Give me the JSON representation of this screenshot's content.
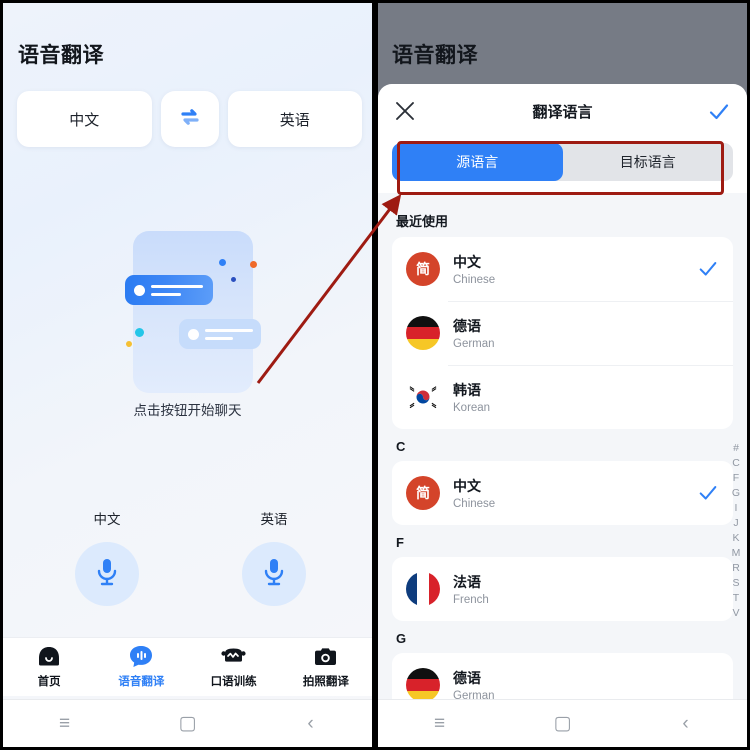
{
  "left": {
    "title": "语音翻译",
    "source_lang": "中文",
    "target_lang": "英语",
    "swap_icon": "swap-horizontal-icon",
    "hint": "点击按钮开始聊天",
    "mic_left_label": "中文",
    "mic_right_label": "英语",
    "mic_icon": "microphone-icon",
    "tabs": [
      {
        "label": "首页",
        "icon": "home-robot-icon",
        "active": false
      },
      {
        "label": "语音翻译",
        "icon": "voice-bubble-icon",
        "active": true
      },
      {
        "label": "口语训练",
        "icon": "speech-train-icon",
        "active": false
      },
      {
        "label": "拍照翻译",
        "icon": "camera-icon",
        "active": false
      }
    ]
  },
  "right": {
    "title": "语音翻译",
    "sheet": {
      "title": "翻译语言",
      "close_icon": "close-icon",
      "confirm_icon": "check-icon",
      "tabs": [
        {
          "label": "源语言",
          "active": true
        },
        {
          "label": "目标语言",
          "active": false
        }
      ],
      "sections": [
        {
          "header": "最近使用",
          "rows": [
            {
              "cn": "中文",
              "en": "Chinese",
              "flag": "cn-simplified-badge",
              "badge_text": "简",
              "checked": true
            },
            {
              "cn": "德语",
              "en": "German",
              "flag": "germany-flag",
              "checked": false
            },
            {
              "cn": "韩语",
              "en": "Korean",
              "flag": "korea-flag",
              "checked": false
            }
          ]
        },
        {
          "header": "C",
          "rows": [
            {
              "cn": "中文",
              "en": "Chinese",
              "flag": "cn-simplified-badge",
              "badge_text": "简",
              "checked": true
            }
          ]
        },
        {
          "header": "F",
          "rows": [
            {
              "cn": "法语",
              "en": "French",
              "flag": "france-flag",
              "checked": false
            }
          ]
        },
        {
          "header": "G",
          "rows": [
            {
              "cn": "德语",
              "en": "German",
              "flag": "germany-flag",
              "checked": false
            }
          ]
        }
      ],
      "alpha_index": [
        "#",
        "C",
        "F",
        "G",
        "I",
        "J",
        "K",
        "M",
        "R",
        "S",
        "T",
        "V"
      ]
    }
  },
  "system_nav": {
    "recents": "≡",
    "home": "▢",
    "back": "‹"
  },
  "colors": {
    "accent_blue": "#2f80f6",
    "annotation_red": "#9e1b12",
    "badge_red": "#d4442a",
    "dim_overlay": "#767b85"
  }
}
